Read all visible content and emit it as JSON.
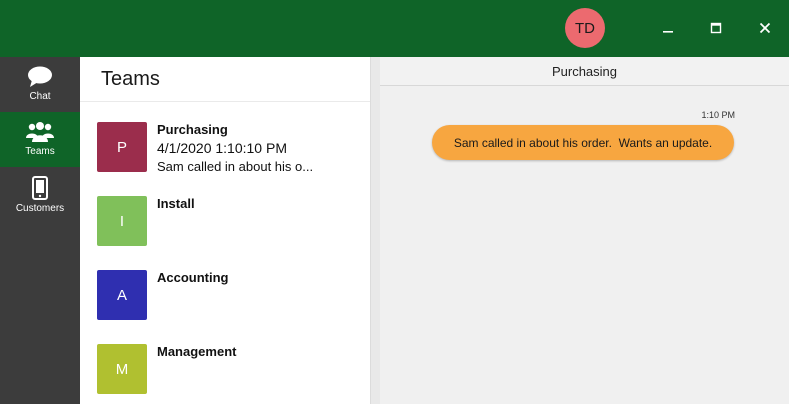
{
  "titlebar": {
    "avatar_initials": "TD",
    "colors": {
      "background": "#0f6428",
      "avatar": "#ec6a6f"
    }
  },
  "nav": {
    "items": [
      {
        "label": "Chat",
        "icon": "chat-bubble-icon",
        "active": false
      },
      {
        "label": "Teams",
        "icon": "people-icon",
        "active": true
      },
      {
        "label": "Customers",
        "icon": "mobile-phone-icon",
        "active": false
      }
    ]
  },
  "teams": {
    "title": "Teams",
    "items": [
      {
        "initial": "P",
        "name": "Purchasing",
        "date": "4/1/2020 1:10:10 PM",
        "preview": "Sam called in about his o...",
        "color": "#9b2d4c"
      },
      {
        "initial": "I",
        "name": "Install",
        "date": "",
        "preview": "",
        "color": "#80c05a"
      },
      {
        "initial": "A",
        "name": "Accounting",
        "date": "",
        "preview": "",
        "color": "#2f2fb0"
      },
      {
        "initial": "M",
        "name": "Management",
        "date": "",
        "preview": "",
        "color": "#b0c030"
      }
    ]
  },
  "chat": {
    "header": "Purchasing",
    "messages": [
      {
        "time": "1:10 PM",
        "text": "Sam called in about his order.  Wants an update.",
        "color": "#f7a640"
      }
    ]
  }
}
